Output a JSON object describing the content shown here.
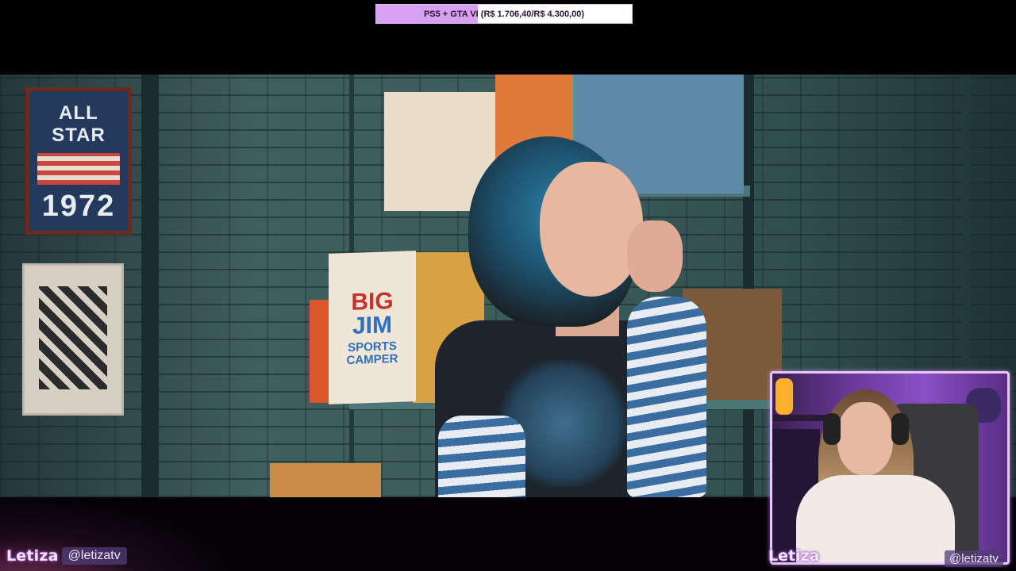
{
  "goal": {
    "text": "PS5 + GTA VI (R$ 1.706,40/R$ 4.300,00)",
    "progress_fraction": 0.397,
    "fill_color": "#d7a0f3",
    "track_color": "#ffffff"
  },
  "video": {
    "poster_allstar": {
      "line1": "ALL STAR",
      "line2": "1972"
    },
    "box_bigjim": {
      "line1": "BIG",
      "line2": "JIM",
      "line3": "SPORTS CAMPER"
    }
  },
  "streamer": {
    "name": "Letiza",
    "handle": "@letizatv"
  },
  "webcam": {
    "border_color": "#e9c6ff"
  }
}
